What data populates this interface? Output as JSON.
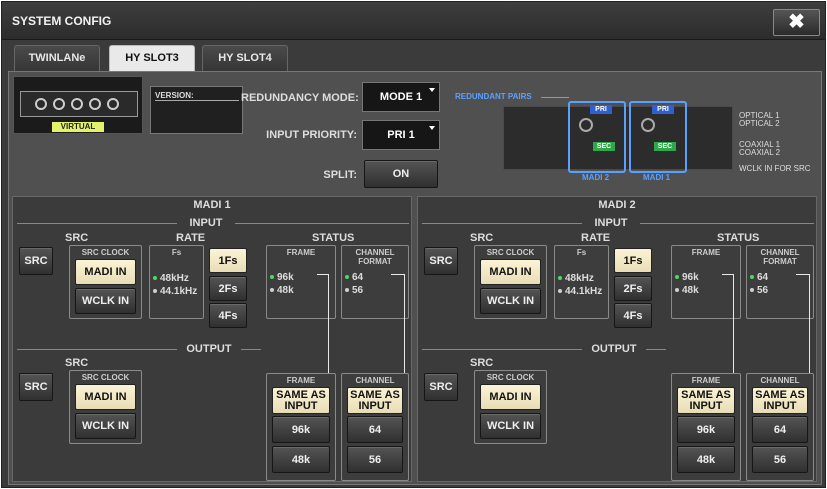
{
  "window": {
    "title": "SYSTEM CONFIG",
    "close": "✖"
  },
  "tabs": [
    "TWINLANe",
    "HY SLOT3",
    "HY SLOT4"
  ],
  "card": {
    "virtual": "VIRTUAL",
    "version_label": "VERSION:"
  },
  "settings": {
    "redundancy_label": "REDUNDANCY MODE:",
    "redundancy_value": "MODE 1",
    "priority_label": "INPUT PRIORITY:",
    "priority_value": "PRI 1",
    "split_label": "SPLIT:",
    "split_value": "ON"
  },
  "redundant": {
    "title": "REDUNDANT PAIRS",
    "pri": "PRI",
    "sec": "SEC",
    "madi2": "MADI 2",
    "madi1": "MADI 1",
    "legend": [
      "OPTICAL 1",
      "OPTICAL 2",
      "COAXIAL 1",
      "COAXIAL 2",
      "WCLK IN FOR SRC"
    ]
  },
  "madi": [
    {
      "title": "MADI 1",
      "input": "INPUT",
      "output": "OUTPUT",
      "src": "SRC",
      "src_btn": "SRC",
      "src_clock": "SRC CLOCK",
      "madi_in": "MADI IN",
      "wclk_in": "WCLK IN",
      "rate": "RATE",
      "fs": "Fs",
      "rate48": "48kHz",
      "rate441": "44.1kHz",
      "fs1": "1Fs",
      "fs2": "2Fs",
      "fs4": "4Fs",
      "status": "STATUS",
      "frame": "FRAME",
      "frame96": "96k",
      "frame48": "48k",
      "chformat": "CHANNEL FORMAT",
      "ch64": "64",
      "ch56": "56",
      "out_src": "SRC",
      "out_src_btn": "SRC",
      "out_src_clock": "SRC CLOCK",
      "out_madi_in": "MADI IN",
      "out_wclk_in": "WCLK IN",
      "out_frame": "FRAME",
      "same1": "SAME AS INPUT",
      "o96": "96k",
      "o48": "48k",
      "out_channel": "CHANNEL",
      "same2": "SAME AS INPUT",
      "o64": "64",
      "o56": "56"
    },
    {
      "title": "MADI 2",
      "input": "INPUT",
      "output": "OUTPUT",
      "src": "SRC",
      "src_btn": "SRC",
      "src_clock": "SRC CLOCK",
      "madi_in": "MADI IN",
      "wclk_in": "WCLK IN",
      "rate": "RATE",
      "fs": "Fs",
      "rate48": "48kHz",
      "rate441": "44.1kHz",
      "fs1": "1Fs",
      "fs2": "2Fs",
      "fs4": "4Fs",
      "status": "STATUS",
      "frame": "FRAME",
      "frame96": "96k",
      "frame48": "48k",
      "chformat": "CHANNEL FORMAT",
      "ch64": "64",
      "ch56": "56",
      "out_src": "SRC",
      "out_src_btn": "SRC",
      "out_src_clock": "SRC CLOCK",
      "out_madi_in": "MADI IN",
      "out_wclk_in": "WCLK IN",
      "out_frame": "FRAME",
      "same1": "SAME AS INPUT",
      "o96": "96k",
      "o48": "48k",
      "out_channel": "CHANNEL",
      "same2": "SAME AS INPUT",
      "o64": "64",
      "o56": "56"
    }
  ],
  "colors": {
    "selected": "#f3ebc8",
    "pri": "#2f5fd0",
    "sec": "#2fa84a",
    "virtual": "#e3f26a",
    "accent_blue": "#5aa0ff"
  }
}
